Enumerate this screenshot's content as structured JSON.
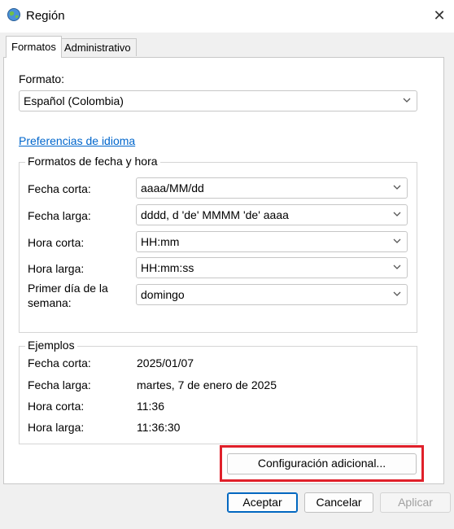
{
  "window": {
    "title": "Región",
    "close": "✕"
  },
  "tabs": [
    {
      "label": "Formatos",
      "active": true
    },
    {
      "label": "Administrativo",
      "active": false
    }
  ],
  "format": {
    "label": "Formato:",
    "value": "Español (Colombia)"
  },
  "language_preferences_link": "Preferencias de idioma",
  "date_time_formats": {
    "title": "Formatos de fecha y hora",
    "rows": [
      {
        "label": "Fecha corta:",
        "value": "aaaa/MM/dd"
      },
      {
        "label": "Fecha larga:",
        "value": "dddd, d 'de' MMMM 'de' aaaa"
      },
      {
        "label": "Hora corta:",
        "value": "HH:mm"
      },
      {
        "label": "Hora larga:",
        "value": "HH:mm:ss"
      },
      {
        "label_line1": "Primer día de la",
        "label_line2": "semana:",
        "value": "domingo"
      }
    ]
  },
  "examples": {
    "title": "Ejemplos",
    "rows": [
      {
        "label": "Fecha corta:",
        "value": "2025/01/07"
      },
      {
        "label": "Fecha larga:",
        "value": "martes, 7 de enero de 2025"
      },
      {
        "label": "Hora corta:",
        "value": "11:36"
      },
      {
        "label": "Hora larga:",
        "value": "11:36:30"
      }
    ]
  },
  "additional_settings_button": "Configuración adicional...",
  "footer": {
    "ok": "Aceptar",
    "cancel": "Cancelar",
    "apply": "Aplicar"
  },
  "colors": {
    "link": "#0066cc",
    "highlight": "#e0202a",
    "primary_border": "#0067c0"
  },
  "icons": {
    "title": "globe-icon",
    "close": "close-icon",
    "dropdown": "chevron-down-icon"
  }
}
